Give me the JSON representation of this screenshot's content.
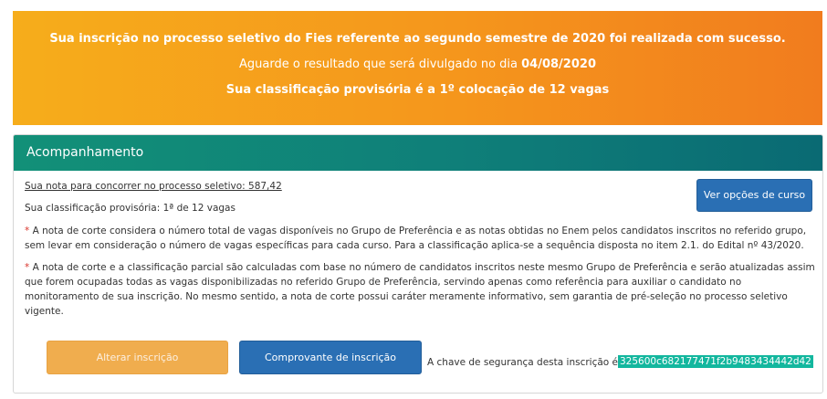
{
  "banner": {
    "line1": "Sua inscrição no processo seletivo do Fies referente ao segundo semestre de 2020 foi realizada com sucesso.",
    "line2_prefix": "Aguarde o resultado que será divulgado no dia ",
    "line2_date": "04/08/2020",
    "line3": "Sua classificação provisória é a 1º colocação de 12 vagas"
  },
  "panel": {
    "title": "Acompanhamento",
    "nota": "Sua nota para concorrer no processo seletivo: 587,42",
    "classificacao": "Sua classificação provisória: 1ª de 12 vagas",
    "note1_star": "*",
    "note1_l1": " A nota de corte considera o número total de vagas disponíveis no Grupo de Preferência e as notas obtidas no Enem pelos candidatos inscritos no referido grupo,",
    "note1_l2": "sem levar em consideração o número de vagas específicas para cada curso. Para a classificação aplica-se a sequência disposta no item 2.1. do Edital nº 43/2020.",
    "note2_star": "*",
    "note2_l1": " A nota de corte e a classificação parcial são calculadas com base no número de candidatos inscritos neste mesmo Grupo de Preferência e serão atualizadas assim",
    "note2_l2": "que forem ocupadas todas as vagas disponibilizadas no referido Grupo de Preferência, servindo apenas como referência para auxiliar o candidato no",
    "note2_l3": "monitoramento de sua inscrição. No mesmo sentido, a nota de corte possui caráter meramente informativo, sem garantia de pré-seleção no processo seletivo",
    "note2_l4": "vigente.",
    "ver_opcoes_label": "Ver opções de curso",
    "alterar_label": "Alterar inscrição",
    "comprovante_label": "Comprovante de inscrição",
    "chave_label": "A chave de segurança desta inscrição é:",
    "chave_value": "325600c682177471f2b9483434442d42"
  },
  "colors": {
    "banner_start": "#f6ad1b",
    "banner_end": "#f17c1e",
    "panel_header": "#0f7f79",
    "primary_button": "#2a6fb4",
    "warning_button": "#f0ad4e",
    "key_highlight": "#13b79e"
  }
}
